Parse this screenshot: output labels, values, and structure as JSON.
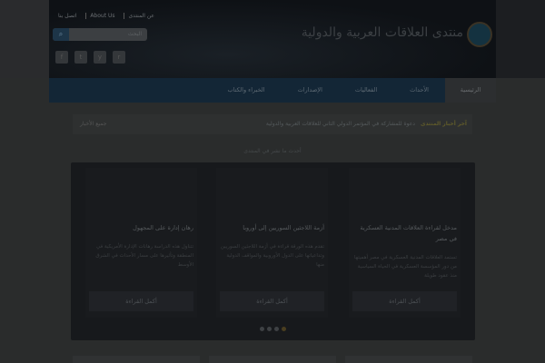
{
  "header": {
    "top_links": [
      "اتصل بنا",
      "About Us",
      "عن المنتدى"
    ],
    "search_placeholder": "البحث",
    "logo_text": "منتدى العلاقات العربية والدولية",
    "social": [
      "f",
      "t",
      "y",
      "r"
    ]
  },
  "nav": {
    "items": [
      "الرئيسية",
      "الأحداث",
      "الفعاليات",
      "الإصدارات",
      "الخبراء والكتاب"
    ]
  },
  "ticker": {
    "label": "آخر أخبار المنتدى",
    "message": "دعوة للمشاركة في المؤتمر الدولي الثاني للعلاقات العربية والدولية",
    "all_link": "جميع الأخبار"
  },
  "section_title": "أحدث ما نشر في المنتدى",
  "cards": [
    {
      "title": "مدخل لقراءة العلاقات المدنية العسكرية في مصر",
      "excerpt": "تستمد العلاقات المدنية العسكرية في مصر أهميتها من دور المؤسسة العسكرية في الحياة السياسية منذ عقود طويلة",
      "button": "أكمل القراءة"
    },
    {
      "title": "أزمة اللاجئين السوريين إلى أوروبا",
      "excerpt": "تقدم هذه الورقة قراءة في أزمة اللاجئين السوريين وتداعياتها على الدول الأوروبية والمواقف الدولية منها",
      "button": "أكمل القراءة"
    },
    {
      "title": "رهان إدارة على المجهول",
      "excerpt": "تتناول هذه الدراسة رهانات الإدارة الأمريكية في المنطقة وتأثيرها على مسار الأحداث في الشرق الأوسط",
      "button": "أكمل القراءة"
    }
  ],
  "slider": {
    "pages": 4,
    "current": 4
  }
}
